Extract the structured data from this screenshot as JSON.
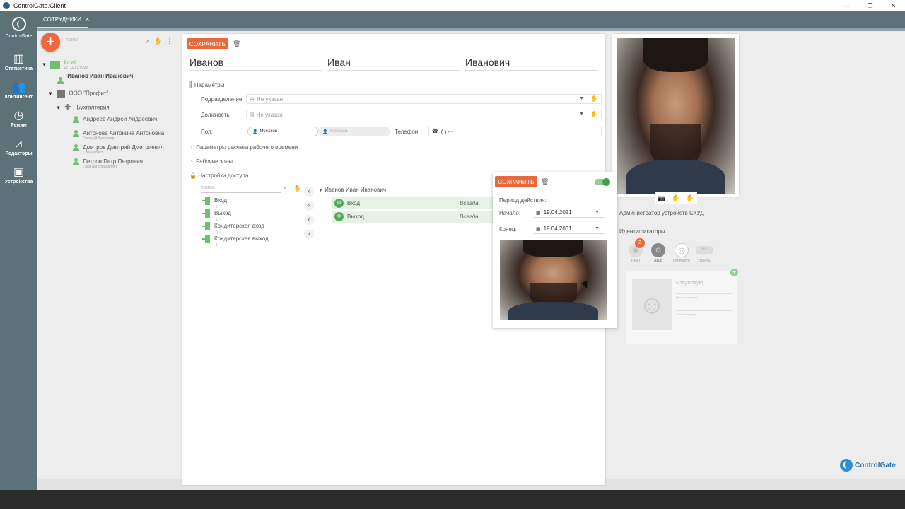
{
  "window": {
    "title": "ControlGate.Client"
  },
  "tabs": [
    {
      "label": "СОТРУДНИКИ",
      "close": "×"
    }
  ],
  "sidebar": {
    "logo": "ControlGate",
    "items": [
      {
        "label": "Статистика",
        "icon": "chart-icon"
      },
      {
        "label": "Контингент",
        "icon": "people-icon"
      },
      {
        "label": "Режим",
        "icon": "clock-icon"
      },
      {
        "label": "Редакторы",
        "icon": "compass-icon"
      },
      {
        "label": "Устройства",
        "icon": "device-icon"
      }
    ]
  },
  "tree": {
    "search_placeholder": "поиск",
    "root": {
      "label": "local",
      "sub": "127.0.0.1:9999"
    },
    "current": "Иванов Иван Иванович",
    "org": "ООО \"Профит\"",
    "dept": "Бухгалтерия",
    "people": [
      {
        "name": "Андреев Андрей Андреевич",
        "sub": ""
      },
      {
        "name": "Антонова Антонина Антоновна",
        "sub": "Главный бухгалтер"
      },
      {
        "name": "Дмитров Дмитрий Дмитриевич",
        "sub": "Специалист"
      },
      {
        "name": "Петров Петр Петрович",
        "sub": "Главный специалист"
      }
    ]
  },
  "form": {
    "save": "СОХРАНИТЬ",
    "last_name": "Иванов",
    "first_name": "Иван",
    "middle_name": "Иванович",
    "params": "Параметры",
    "division_label": "Подразделение:",
    "division_value": "Не указан",
    "position_label": "Должность:",
    "position_value": "Не указан",
    "gender_label": "Пол:",
    "male": "Мужской",
    "female": "Женский",
    "phone_label": "Телефон:",
    "phone_value": "(  )   -  -",
    "worktime": "Параметры расчета рабочего времени",
    "zones": "Рабочие зоны",
    "access": "Настройки доступа",
    "access_search": "поиск",
    "access_points": [
      {
        "name": "Вход",
        "sub": "0, -"
      },
      {
        "name": "Выход",
        "sub": "1, -"
      },
      {
        "name": "Кондитерская вход",
        "sub": "0, -"
      },
      {
        "name": "Кондитерская выход",
        "sub": "1, -"
      }
    ],
    "assigned_user": "Иванов Иван Иванович",
    "assigned": [
      {
        "name": "Вход",
        "mode": "Всегда"
      },
      {
        "name": "Выход",
        "mode": "Всегда"
      }
    ]
  },
  "popup": {
    "save": "СОХРАНИТЬ",
    "period": "Период действия:",
    "start_label": "Начало:",
    "start": "19.04.2021",
    "end_label": "Конец:",
    "end": "19.04.2031"
  },
  "right": {
    "admin_label": "Администратор устройств СКУД",
    "identifiers": "Идентификаторы",
    "rfid_count": "2",
    "id_types": [
      "RFID",
      "Лицо",
      "Отпечаток",
      "Пароль"
    ],
    "face_status": "Отсутствует",
    "face_line1": "Начало периода",
    "face_line2": "Конец периода"
  },
  "brand": "ControlGate",
  "colors": {
    "accent": "#e8693c",
    "green": "#52ad55",
    "sidebar": "#5c7178"
  }
}
